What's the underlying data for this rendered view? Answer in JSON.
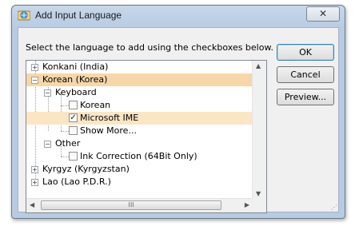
{
  "window": {
    "title": "Add Input Language",
    "close_glyph": "✕"
  },
  "instructions": "Select the language to add using the checkboxes below.",
  "tree": {
    "items": [
      {
        "label": "Konkani (India)",
        "expander": "+"
      },
      {
        "label": "Korean (Korea)",
        "expander": "−"
      },
      {
        "label": "Keyboard",
        "expander": "−"
      },
      {
        "label": "Korean",
        "checked": false,
        "mark": ""
      },
      {
        "label": "Microsoft IME",
        "checked": true,
        "mark": "✓"
      },
      {
        "label": "Show More...",
        "checked": false,
        "mark": ""
      },
      {
        "label": "Other",
        "expander": "−"
      },
      {
        "label": "Ink Correction (64Bit Only)",
        "checked": false,
        "mark": ""
      },
      {
        "label": "Kyrgyz (Kyrgyzstan)",
        "expander": "+"
      },
      {
        "label": "Lao (Lao P.D.R.)",
        "expander": "+"
      }
    ],
    "hscroll_grip": "III",
    "up_arrow": "▲",
    "down_arrow": "▼",
    "left_arrow": "◀",
    "right_arrow": "▶"
  },
  "buttons": {
    "ok": "OK",
    "cancel": "Cancel",
    "preview": "Preview..."
  },
  "colors": {
    "selection": "#f7d7a8",
    "window_frame": "#b7cbe2"
  }
}
